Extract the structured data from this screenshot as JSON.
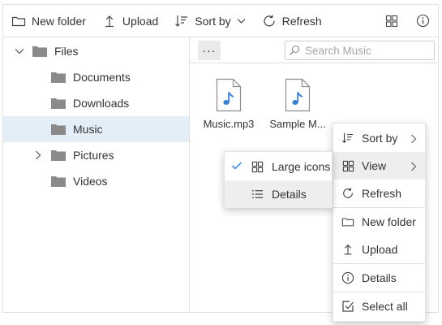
{
  "toolbar": {
    "new_folder": "New folder",
    "upload": "Upload",
    "sort_by": "Sort by",
    "refresh": "Refresh",
    "right_icons": [
      "large-icons-view-icon",
      "info-icon"
    ]
  },
  "nav": {
    "root": "Files",
    "items": [
      {
        "label": "Documents",
        "expandable": false
      },
      {
        "label": "Downloads",
        "expandable": false
      },
      {
        "label": "Music",
        "expandable": false,
        "selected": true
      },
      {
        "label": "Pictures",
        "expandable": true
      },
      {
        "label": "Videos",
        "expandable": false
      }
    ]
  },
  "content": {
    "more": "···",
    "search_placeholder": "Search Music",
    "files": [
      {
        "name": "Music.mp3",
        "icon": "music-file-icon"
      },
      {
        "name": "Sample M...",
        "icon": "music-file-icon"
      }
    ]
  },
  "context_menu": {
    "items": [
      {
        "label": "Sort by",
        "icon": "sort-icon",
        "submenu": true
      },
      {
        "label": "View",
        "icon": "grid-icon",
        "submenu": true,
        "highlighted": true
      },
      {
        "label": "Refresh",
        "icon": "refresh-icon"
      },
      {
        "label": "New folder",
        "icon": "folder-outline-icon"
      },
      {
        "label": "Upload",
        "icon": "upload-icon"
      },
      {
        "label": "Details",
        "icon": "info-icon"
      },
      {
        "label": "Select all",
        "icon": "select-all-icon"
      }
    ]
  },
  "view_submenu": {
    "items": [
      {
        "label": "Large icons",
        "checked": true,
        "icon": "grid-icon"
      },
      {
        "label": "Details",
        "checked": false,
        "icon": "list-icon",
        "highlighted": true
      }
    ]
  },
  "colors": {
    "accent": "#2f7bd6",
    "selection": "#e3eef8",
    "folder": "#8a8a8a",
    "music_file": "#3a7fd0"
  }
}
